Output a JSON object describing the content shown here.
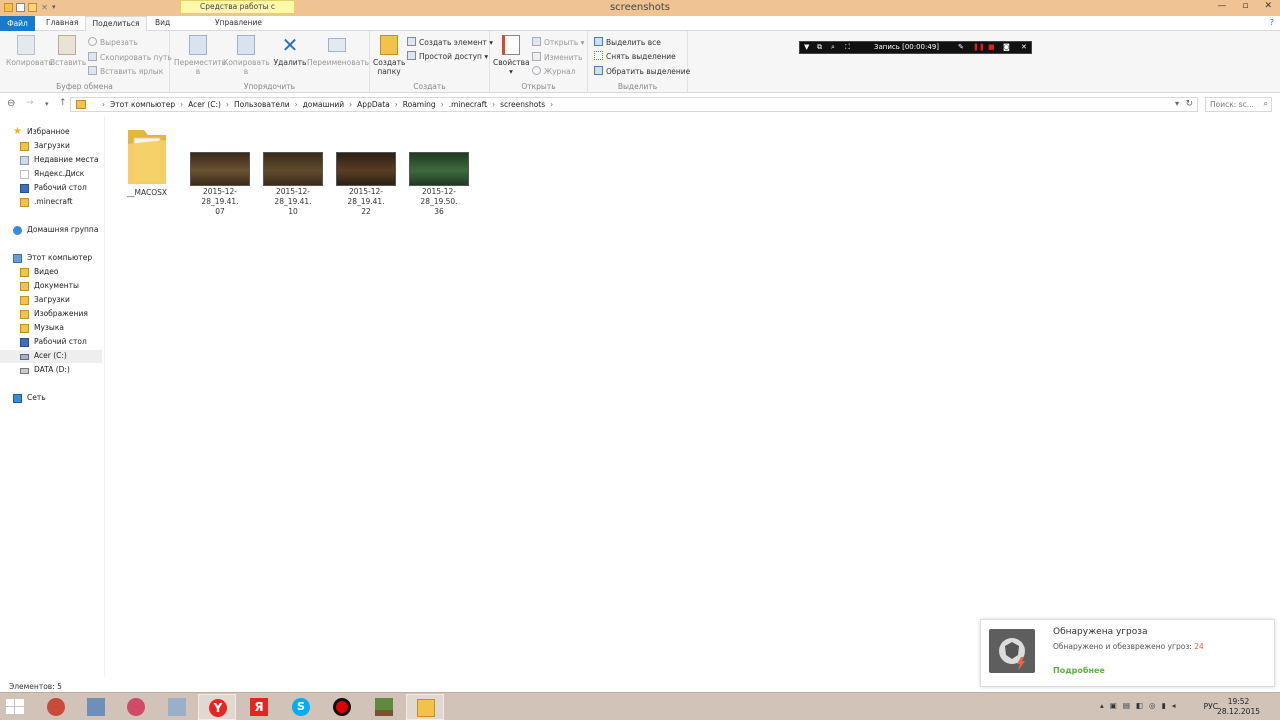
{
  "window": {
    "title": "screenshots",
    "context_tab_group": "Средства работы с рисунками",
    "minimize": "—",
    "maximize": "▫",
    "close": "✕"
  },
  "tabs": {
    "file": "Файл",
    "home": "Главная",
    "share": "Поделиться",
    "view": "Вид",
    "manage": "Управление"
  },
  "ribbon": {
    "clipboard": {
      "label": "Буфер обмена",
      "copy": "Копировать",
      "paste": "Вставить",
      "cut": "Вырезать",
      "copy_path": "Скопировать путь",
      "paste_shortcut": "Вставить ярлык"
    },
    "organize": {
      "label": "Упорядочить",
      "move_to_1": "Переместить",
      "move_to_2": "в",
      "copy_to_1": "Копировать",
      "copy_to_2": "в",
      "delete": "Удалить",
      "rename": "Переименовать"
    },
    "create": {
      "label": "Создать",
      "new_folder_1": "Создать",
      "new_folder_2": "папку",
      "new_item": "Создать элемент ▾",
      "easy_access": "Простой доступ ▾"
    },
    "open": {
      "label": "Открыть",
      "properties": "Свойства",
      "open": "Открыть ▾",
      "edit": "Изменить",
      "history": "Журнал"
    },
    "select": {
      "label": "Выделить",
      "select_all": "Выделить все",
      "select_none": "Снять выделение",
      "invert": "Обратить выделение"
    }
  },
  "recorder": {
    "label": "Запись [00:00:49]"
  },
  "address": {
    "crumbs": [
      "Этот компьютер",
      "Acer (C:)",
      "Пользователи",
      "домашний",
      "AppData",
      "Roaming",
      ".minecraft",
      "screenshots"
    ],
    "search_placeholder": "Поиск: sc..."
  },
  "nav": {
    "favorites": "Избранное",
    "fav_items": [
      "Загрузки",
      "Недавние места",
      "Яндекс.Диск",
      "Рабочий стол",
      ".minecraft"
    ],
    "homegroup": "Домашняя группа",
    "this_pc": "Этот компьютер",
    "pc_items": [
      "Видео",
      "Документы",
      "Загрузки",
      "Изображения",
      "Музыка",
      "Рабочий стол",
      "Acer (C:)",
      "DATA (D:)"
    ],
    "network": "Сеть"
  },
  "files": [
    {
      "name_1": "__MACOSX",
      "name_2": "",
      "type": "folder"
    },
    {
      "name_1": "2015-12-28_19.41.",
      "name_2": "07",
      "type": "image",
      "colors": [
        "#3a2a18",
        "#6b5232"
      ]
    },
    {
      "name_1": "2015-12-28_19.41.",
      "name_2": "10",
      "type": "image",
      "colors": [
        "#3b2c1a",
        "#5f4a2c"
      ]
    },
    {
      "name_1": "2015-12-28_19.41.",
      "name_2": "22",
      "type": "image",
      "colors": [
        "#2c1f14",
        "#5a3e24"
      ]
    },
    {
      "name_1": "2015-12-28_19.50.",
      "name_2": "36",
      "type": "image",
      "colors": [
        "#1f3a22",
        "#3f6a3c"
      ]
    }
  ],
  "status": {
    "items": "Элементов: 5"
  },
  "toast": {
    "title": "Обнаружена угроза",
    "message": "Обнаружено и обезврежено угроз: ",
    "count": "24",
    "link": "Подробнее"
  },
  "taskbar": {
    "lang": "РУС",
    "time": "19:52",
    "date": "28.12.2015"
  },
  "colors": {
    "titlebar": "#efc392",
    "file_tab": "#1979ca",
    "taskbar": "#d2c3b8",
    "toast_link": "#60b040",
    "toast_count": "#e0603a"
  }
}
